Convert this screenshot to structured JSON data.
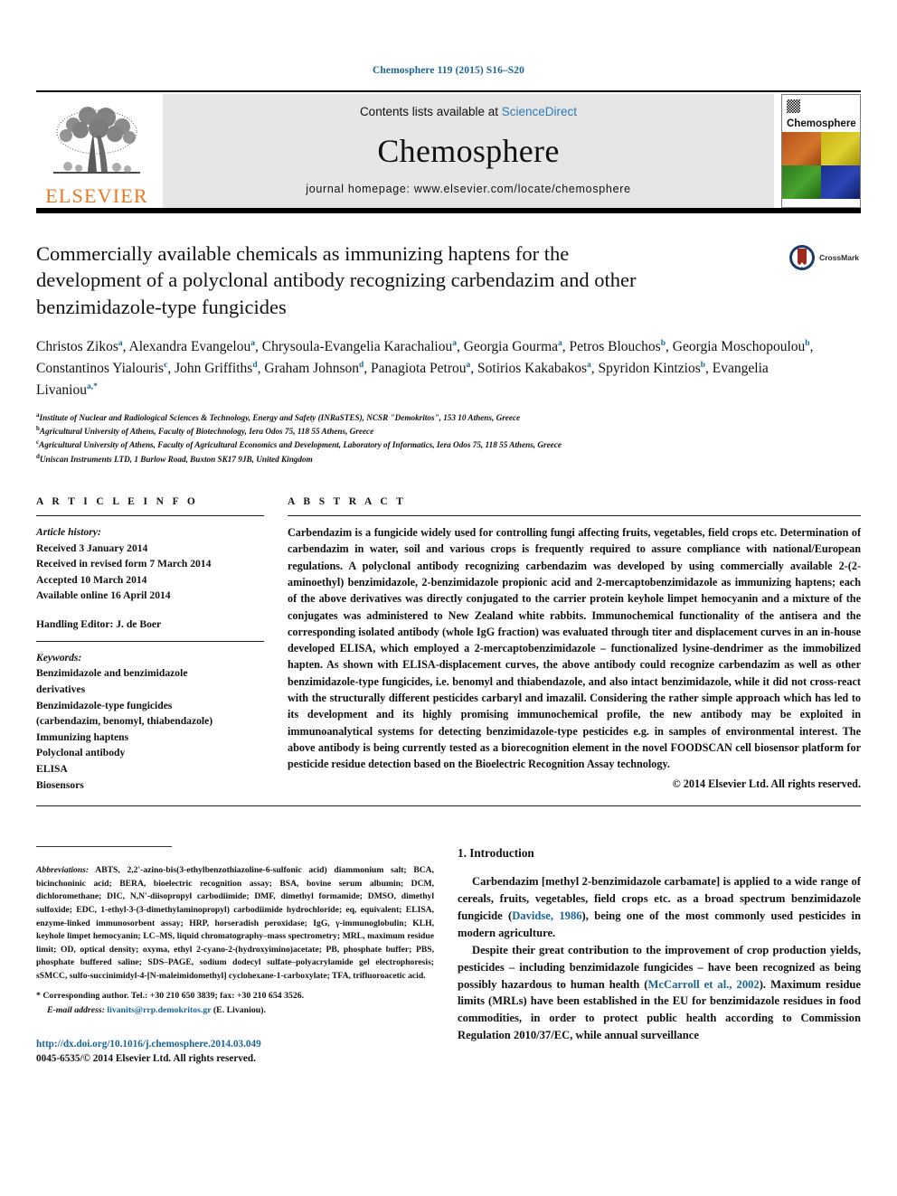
{
  "running_head": "Chemosphere 119 (2015) S16–S20",
  "masthead": {
    "publisher": "ELSEVIER",
    "contents_prefix": "Contents lists available at ",
    "sciencedirect": "ScienceDirect",
    "journal_name": "Chemosphere",
    "homepage": "journal homepage: www.elsevier.com/locate/chemosphere",
    "cover_title": "Chemosphere"
  },
  "article": {
    "title": "Commercially available chemicals as immunizing haptens for the development of a polyclonal antibody recognizing carbendazim and other benzimidazole-type fungicides",
    "crossmark_label": "CrossMark",
    "authors": [
      {
        "name": "Christos Zikos",
        "sup": "a",
        "sep": ","
      },
      {
        "name": "Alexandra Evangelou",
        "sup": "a",
        "sep": ","
      },
      {
        "name": "Chrysoula-Evangelia Karachaliou",
        "sup": "a",
        "sep": ","
      },
      {
        "name": "Georgia Gourma",
        "sup": "a",
        "sep": ","
      },
      {
        "name": "Petros Blouchos",
        "sup": "b",
        "sep": ","
      },
      {
        "name": "Georgia Moschopoulou",
        "sup": "b",
        "sep": ","
      },
      {
        "name": "Constantinos Yialouris",
        "sup": "c",
        "sep": ","
      },
      {
        "name": "John Griffiths",
        "sup": "d",
        "sep": ","
      },
      {
        "name": "Graham Johnson",
        "sup": "d",
        "sep": ","
      },
      {
        "name": "Panagiota Petrou",
        "sup": "a",
        "sep": ","
      },
      {
        "name": "Sotirios Kakabakos",
        "sup": "a",
        "sep": ","
      },
      {
        "name": "Spyridon Kintzios",
        "sup": "b",
        "sep": ","
      },
      {
        "name": "Evangelia Livaniou",
        "sup": "a,*",
        "sep": ""
      }
    ],
    "affiliations": [
      {
        "sup": "a",
        "text": "Institute of Nuclear and Radiological Sciences & Technology, Energy and Safety (INRaSTES), NCSR \"Demokritos\", 153 10 Athens, Greece"
      },
      {
        "sup": "b",
        "text": "Agricultural University of Athens, Faculty of Biotechnology, Iera Odos 75, 118 55 Athens, Greece"
      },
      {
        "sup": "c",
        "text": "Agricultural University of Athens, Faculty of Agricultural Economics and Development, Laboratory of Informatics, Iera Odos 75, 118 55 Athens, Greece"
      },
      {
        "sup": "d",
        "text": "Uniscan Instruments LTD, 1 Burlow Road, Buxton SK17 9JB, United Kingdom"
      }
    ]
  },
  "article_info": {
    "heading": "A R T I C L E   I N F O",
    "history_label": "Article history:",
    "history": [
      "Received 3 January 2014",
      "Received in revised form 7 March 2014",
      "Accepted 10 March 2014",
      "Available online 16 April 2014"
    ],
    "handling_editor": "Handling Editor: J. de Boer",
    "keywords_label": "Keywords:",
    "keywords": [
      "Benzimidazole and benzimidazole",
      "derivatives",
      "Benzimidazole-type fungicides",
      "(carbendazim, benomyl, thiabendazole)",
      "Immunizing haptens",
      "Polyclonal antibody",
      "ELISA",
      "Biosensors"
    ]
  },
  "abstract": {
    "heading": "A B S T R A C T",
    "body": "Carbendazim is a fungicide widely used for controlling fungi affecting fruits, vegetables, field crops etc. Determination of carbendazim in water, soil and various crops is frequently required to assure compliance with national/European regulations. A polyclonal antibody recognizing carbendazim was developed by using commercially available 2-(2-aminoethyl) benzimidazole, 2-benzimidazole propionic acid and 2-mercaptobenzimidazole as immunizing haptens; each of the above derivatives was directly conjugated to the carrier protein keyhole limpet hemocyanin and a mixture of the conjugates was administered to New Zealand white rabbits. Immunochemical functionality of the antisera and the corresponding isolated antibody (whole IgG fraction) was evaluated through titer and displacement curves in an in-house developed ELISA, which employed a 2-mercaptobenzimidazole – functionalized lysine-dendrimer as the immobilized hapten. As shown with ELISA-displacement curves, the above antibody could recognize carbendazim as well as other benzimidazole-type fungicides, i.e. benomyl and thiabendazole, and also intact benzimidazole, while it did not cross-react with the structurally different pesticides carbaryl and imazalil. Considering the rather simple approach which has led to its development and its highly promising immunochemical profile, the new antibody may be exploited in immunoanalytical systems for detecting benzimidazole-type pesticides e.g. in samples of environmental interest. The above antibody is being currently tested as a biorecognition element in the novel FOODSCAN cell biosensor platform for pesticide residue detection based on the Bioelectric Recognition Assay technology.",
    "copyright": "© 2014 Elsevier Ltd. All rights reserved."
  },
  "footnotes": {
    "abbrev_label": "Abbreviations:",
    "abbrev_text": " ABTS, 2,2′-azino-bis(3-ethylbenzothiazoline-6-sulfonic acid) diammonium salt; BCA, bicinchoninic acid; BERA, bioelectric recognition assay; BSA, bovine serum albumin; DCM, dichloromethane; DIC, N,N′-diisopropyl carbodiimide; DMF, dimethyl formamide; DMSO, dimethyl sulfoxide; EDC, 1-ethyl-3-(3-dimethylaminopropyl) carbodiimide hydrochloride; eq, equivalent; ELISA, enzyme-linked immunosorbent assay; HRP, horseradish peroxidase; IgG, γ-immunoglobulin; KLH, keyhole limpet hemocyanin; LC–MS, liquid chromatography–mass spectrometry; MRL, maximum residue limit; OD, optical density; oxyma, ethyl 2-cyano-2-(hydroxyimino)acetate; PB, phosphate buffer; PBS, phosphate buffered saline; SDS–PAGE, sodium dodecyl sulfate–polyacrylamide gel electrophoresis; sSMCC, sulfo-succinimidyl-4-[N-maleimidomethyl] cyclohexane-1-carboxylate; TFA, trifluoroacetic acid.",
    "corresponding": "* Corresponding author. Tel.: +30 210 650 3839; fax: +30 210 654 3526.",
    "email_label": "E-mail address:",
    "email": "livanits@rrp.demokritos.gr",
    "email_owner": "(E. Livaniou).",
    "doi": "http://dx.doi.org/10.1016/j.chemosphere.2014.03.049",
    "issn": "0045-6535/© 2014 Elsevier Ltd. All rights reserved."
  },
  "introduction": {
    "heading": "1. Introduction",
    "paragraphs": [
      {
        "pre": "Carbendazim [methyl 2-benzimidazole carbamate] is applied to a wide range of cereals, fruits, vegetables, field crops etc. as a broad spectrum benzimidazole fungicide (",
        "cite": "Davidse, 1986",
        "post": "), being one of the most commonly used pesticides in modern agriculture."
      },
      {
        "pre": "Despite their great contribution to the improvement of crop production yields, pesticides – including benzimidazole fungicides – have been recognized as being possibly hazardous to human health (",
        "cite": "McCarroll et al., 2002",
        "post": "). Maximum residue limits (MRLs) have been established in the EU for benzimidazole residues in food commodities, in order to protect public health according to Commission Regulation 2010/37/EC, while annual surveillance"
      }
    ]
  },
  "colors": {
    "link": "#1a6496",
    "elsevier_orange": "#E87722",
    "sciencedirect": "#2b7bb9"
  }
}
